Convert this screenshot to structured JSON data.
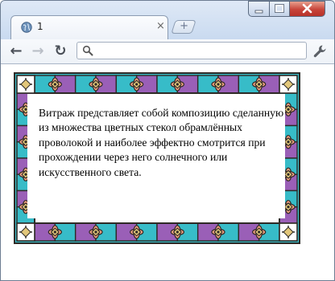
{
  "tab": {
    "title": "1",
    "close": "×"
  },
  "new_tab": "+",
  "toolbar": {
    "back": "←",
    "forward": "→",
    "reload": "↻"
  },
  "omnibox": {
    "value": "",
    "placeholder": ""
  },
  "page": {
    "paragraph": "Витраж представляет собой композицию сделанную из множества цветных стекол обрамлённых проволокой и наиболее эффектно смотрится при прохождении через него солнечного или искусственного света."
  },
  "colors": {
    "teal": "#37bcc8",
    "purple": "#9a5fb7",
    "salmon": "#f2a080",
    "gold": "#e2c77a",
    "lead": "#2e2a26",
    "close": "#c7443a"
  }
}
